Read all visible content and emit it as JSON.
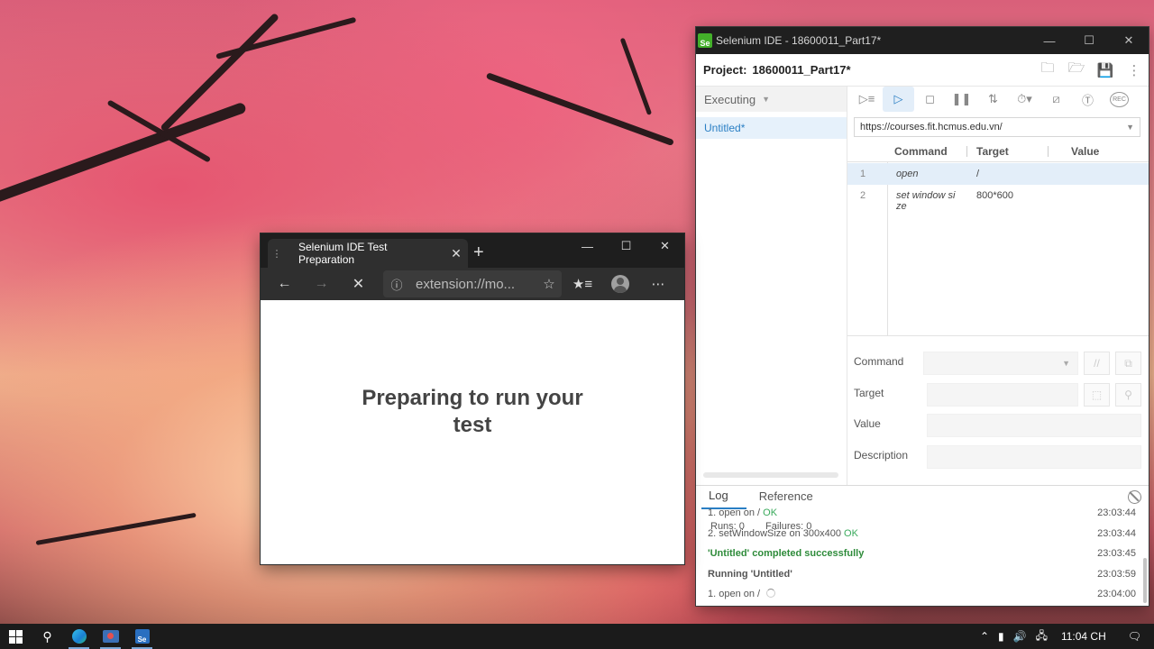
{
  "ide": {
    "window_title": "Selenium IDE - 18600011_Part17*",
    "logo_text": "Se",
    "project_label": "Project:",
    "project_name": "18600011_Part17*",
    "project_icons": [
      "new-folder-icon",
      "open-folder-icon",
      "save-icon",
      "more-vert-icon"
    ],
    "executing_label": "Executing",
    "test_name": "Untitled*",
    "base_url": "https://courses.fit.hcmus.edu.vn/",
    "toolbar_icons": [
      "run-all-icon",
      "run-icon",
      "stop-icon",
      "pause-icon",
      "step-icon",
      "speed-icon",
      "disable-breakpoints-icon",
      "pause-exceptions-icon",
      "record-icon"
    ],
    "record_label": "REC",
    "columns": {
      "command": "Command",
      "target": "Target",
      "value": "Value"
    },
    "commands": [
      {
        "num": "1",
        "command": "open",
        "target": "/",
        "value": ""
      },
      {
        "num": "2",
        "command": "set window si ze",
        "target": "800*600",
        "value": ""
      }
    ],
    "editor": {
      "command_label": "Command",
      "target_label": "Target",
      "value_label": "Value",
      "description_label": "Description"
    },
    "runs_label": "Runs: 0",
    "failures_label": "Failures: 0",
    "log_tabs": {
      "log": "Log",
      "reference": "Reference"
    },
    "log": [
      {
        "text": "1.  open on / ",
        "status": "OK",
        "time": "23:03:44"
      },
      {
        "text": "2.  setWindowSize on 300x400 ",
        "status": "OK",
        "time": "23:03:44"
      },
      {
        "text": "'Untitled' completed successfully",
        "status": "",
        "time": "23:03:45"
      },
      {
        "text": "Running 'Untitled'",
        "status": "",
        "time": "23:03:59"
      },
      {
        "text": "1.  open on / ",
        "status": "",
        "time": "23:04:00"
      }
    ]
  },
  "browser": {
    "tab_title": "Selenium IDE Test Preparation",
    "address": "extension://mo...",
    "heading": "Preparing to run your test"
  },
  "taskbar": {
    "clock": "11:04 CH",
    "tray_icons": [
      "chevron-up-icon",
      "battery-icon",
      "volume-icon",
      "network-icon",
      "notification-icon"
    ]
  }
}
